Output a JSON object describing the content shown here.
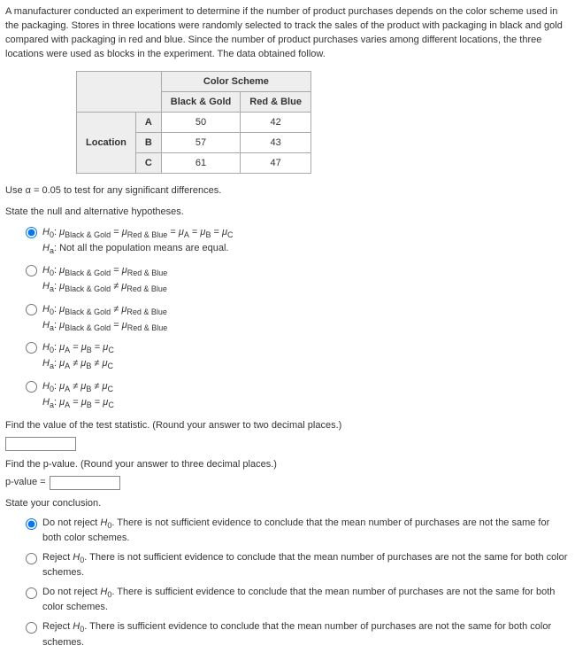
{
  "intro": "A manufacturer conducted an experiment to determine if the number of product purchases depends on the color scheme used in the packaging. Stores in three locations were randomly selected to track the sales of the product with packaging in black and gold compared with packaging in red and blue. Since the number of product purchases varies among different locations, the three locations were used as blocks in the experiment. The data obtained follow.",
  "table": {
    "superheader": "Color Scheme",
    "col1": "Black & Gold",
    "col2": "Red & Blue",
    "rowheader": "Location",
    "rows": [
      {
        "loc": "A",
        "v1": "50",
        "v2": "42"
      },
      {
        "loc": "B",
        "v1": "57",
        "v2": "43"
      },
      {
        "loc": "C",
        "v1": "61",
        "v2": "47"
      }
    ]
  },
  "alpha_line": "Use α = 0.05 to test for any significant differences.",
  "hyp_prompt": "State the null and alternative hypotheses.",
  "hyp": {
    "o1_h0": "H₀: μBlack & Gold = μRed & Blue = μA = μB = μC",
    "o1_ha": "Hₐ: Not all the population means are equal.",
    "o2_h0": "H₀: μBlack & Gold = μRed & Blue",
    "o2_ha": "Hₐ: μBlack & Gold ≠ μRed & Blue",
    "o3_h0": "H₀: μBlack & Gold ≠ μRed & Blue",
    "o3_ha": "Hₐ: μBlack & Gold = μRed & Blue",
    "o4_h0": "H₀: μA = μB = μC",
    "o4_ha": "Hₐ: μA ≠ μB ≠ μC",
    "o5_h0": "H₀: μA ≠ μB ≠ μC",
    "o5_ha": "Hₐ: μA = μB = μC"
  },
  "test_stat_prompt": "Find the value of the test statistic. (Round your answer to two decimal places.)",
  "pvalue_prompt": "Find the p-value. (Round your answer to three decimal places.)",
  "pvalue_label": "p-value =",
  "conclusion_prompt": "State your conclusion.",
  "conc": {
    "c1": "Do not reject H₀. There is not sufficient evidence to conclude that the mean number of purchases are not the same for both color schemes.",
    "c2": "Reject H₀. There is not sufficient evidence to conclude that the mean number of purchases are not the same for both color schemes.",
    "c3": "Do not reject H₀. There is sufficient evidence to conclude that the mean number of purchases are not the same for both color schemes.",
    "c4": "Reject H₀. There is sufficient evidence to conclude that the mean number of purchases are not the same for both color schemes."
  }
}
